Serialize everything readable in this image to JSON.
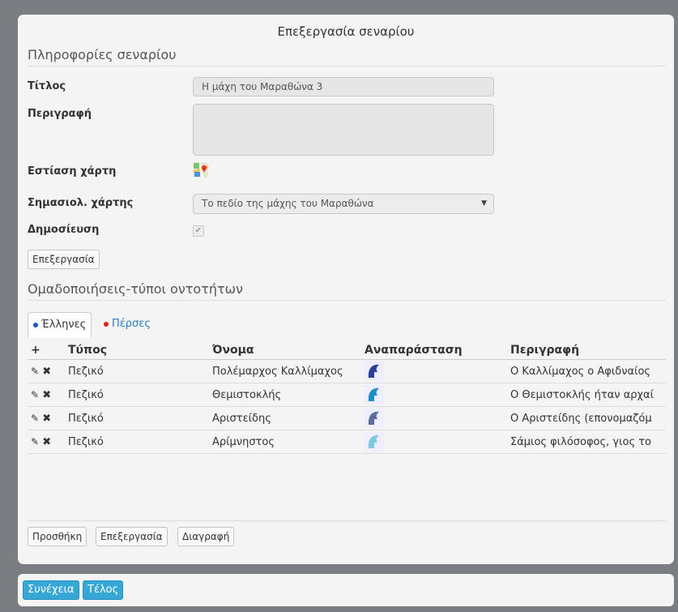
{
  "dialog": {
    "title": "Επεξεργασία σεναρίου",
    "info_section": "Πληροφορίες σεναρίου",
    "fields": {
      "title_label": "Τίτλος",
      "title_value": "Η μάχη του Μαραθώνα 3",
      "description_label": "Περιγραφή",
      "description_value": "",
      "map_focus_label": "Εστίαση χάρτη",
      "map_marker_label": "Σημασιολ. χάρτης",
      "map_marker_value": "Το πεδίο της μάχης του Μαραθώνα",
      "publish_label": "Δημοσίευση",
      "publish_checked": true
    },
    "edit_button": "Επεξεργασία",
    "groups_section": "Ομαδοποιήσεις-τύποι οντοτήτων",
    "tabs": [
      {
        "label": "Έλληνες",
        "dot_color": "#1a56c8",
        "active": true
      },
      {
        "label": "Πέρσες",
        "dot_color": "#e0201e",
        "active": false
      }
    ],
    "table": {
      "add_symbol": "+",
      "headers": [
        "Τύπος",
        "Όνομα",
        "Αναπαράσταση",
        "Περιγραφή"
      ],
      "rows": [
        {
          "type": "Πεζικό",
          "name": "Πολέμαρχος Καλλίμαχος",
          "icon_color": "#2c3f9c",
          "description": "Ο Καλλίμαχος ο Αφιδναίος"
        },
        {
          "type": "Πεζικό",
          "name": "Θεμιστοκλής",
          "icon_color": "#1c8ec8",
          "description": "Ο Θεμιστοκλής ήταν αρχαί"
        },
        {
          "type": "Πεζικό",
          "name": "Αριστείδης",
          "icon_color": "#5a6f9c",
          "description": "Ο Αριστείδης (επονομαζόμ"
        },
        {
          "type": "Πεζικό",
          "name": "Αρίμνηστος",
          "icon_color": "#7ec8e0",
          "description": "Σάμιος φιλόσοφος, γιος το"
        }
      ]
    },
    "footer_buttons": {
      "add": "Προσθήκη",
      "edit": "Επεξεργασία",
      "delete": "Διαγραφή"
    }
  },
  "bottom_bar": {
    "continue": "Συνέχεια",
    "finish": "Τέλος"
  }
}
